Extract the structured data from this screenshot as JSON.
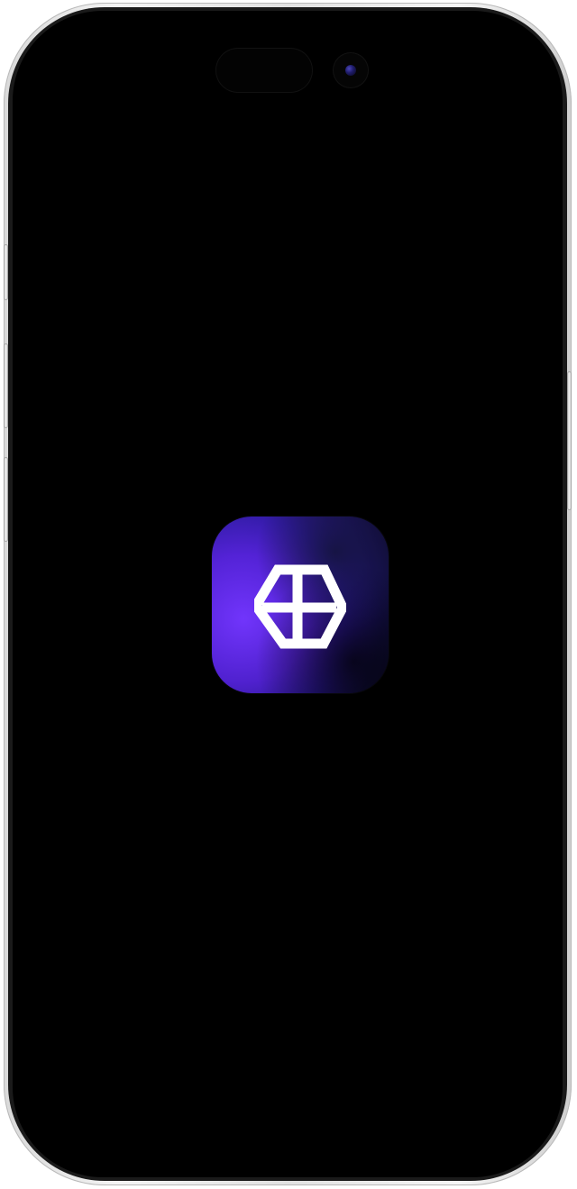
{
  "device": {
    "model": "phone",
    "frame_color": "#e5e5e5",
    "screen_color": "#000000"
  },
  "splash": {
    "app_icon": {
      "icon_name": "hexagon-grid-icon",
      "gradient_colors": [
        "#5d33e6",
        "#3f1fbf",
        "#1b1467",
        "#090b1e"
      ]
    }
  }
}
